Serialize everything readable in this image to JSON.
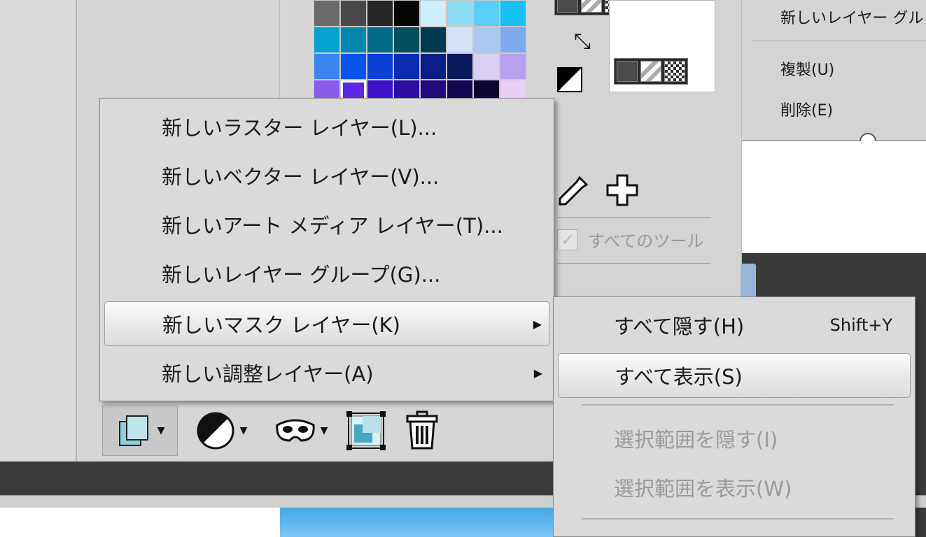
{
  "palette": {
    "colors": [
      "#6a6a6a",
      "#484848",
      "#262626",
      "#050505",
      "#cdeefa",
      "#8fdcf7",
      "#5bcff6",
      "#17c1f3",
      "#04a3cf",
      "#0487ad",
      "#036c86",
      "#034f5e",
      "#023b4d",
      "#d3e3f8",
      "#a9c8f2",
      "#7da9ee",
      "#3a86ee",
      "#0a55ee",
      "#0a40d6",
      "#0a2dad",
      "#0a1f85",
      "#0a185d",
      "#dccff5",
      "#b7a0ef",
      "#8a5cea",
      "#5d26e6",
      "#3d12c8",
      "#2e0ea3",
      "#220a7d",
      "#150650",
      "#0f0531",
      "#e9cff6"
    ],
    "selected_index": 25
  },
  "right_menu": {
    "items": [
      "新しいレイヤー グル",
      "複製(U)",
      "削除(E)"
    ]
  },
  "tools": {
    "swap_icon": "swap-colors-icon",
    "all_tools_label": "すべてのツール",
    "all_tools_checked": true
  },
  "main_menu": {
    "items": [
      {
        "label": "新しいラスター レイヤー(L)...",
        "submenu": false
      },
      {
        "label": "新しいベクター レイヤー(V)...",
        "submenu": false
      },
      {
        "label": "新しいアート メディア レイヤー(T)...",
        "submenu": false
      },
      {
        "label": "新しいレイヤー グループ(G)...",
        "submenu": false
      },
      {
        "label": "新しいマスク レイヤー(K)",
        "submenu": true,
        "highlighted": true
      },
      {
        "label": "新しい調整レイヤー(A)",
        "submenu": true
      }
    ]
  },
  "sub_menu": {
    "items": [
      {
        "label": "すべて隠す(H)",
        "shortcut": "Shift+Y"
      },
      {
        "label": "すべて表示(S)",
        "highlighted": true
      },
      {
        "label": "選択範囲を隠す(I)",
        "disabled": true
      },
      {
        "label": "選択範囲を表示(W)",
        "disabled": true
      }
    ]
  },
  "toolbar": {
    "buttons": [
      "new-layer-icon",
      "adjustment-layer-icon",
      "mask-icon",
      "layer-frame-icon",
      "trash-icon"
    ]
  }
}
